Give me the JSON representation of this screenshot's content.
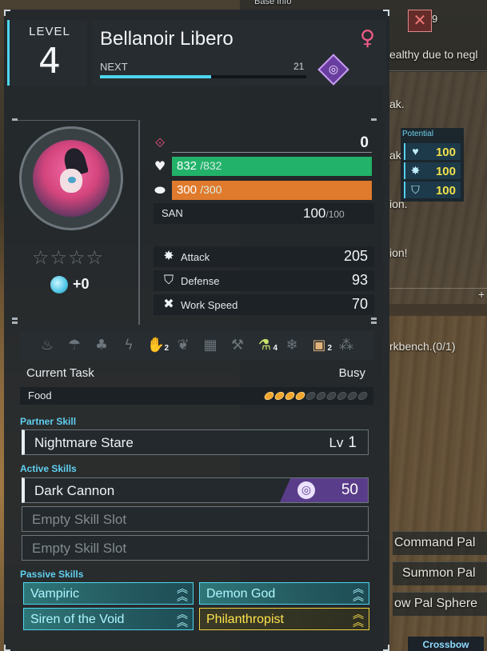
{
  "background": {
    "base_info": "Base Info",
    "notice_count": "9",
    "lines": [
      "ealthy due to negl",
      "ak.",
      "ak.",
      "ion.",
      "ion!"
    ],
    "plus": "+",
    "workbench": "rkbench.(0/1)",
    "buttons": [
      "Command Pal",
      "Summon Pal",
      "ow Pal Sphere"
    ],
    "crossbow": "Crossbow",
    "potential": {
      "label": "Potential",
      "rows": [
        {
          "icon": "heart-icon",
          "value": "100"
        },
        {
          "icon": "attack-icon",
          "value": "100"
        },
        {
          "icon": "shield-icon",
          "value": "100"
        }
      ]
    }
  },
  "header": {
    "level_label": "LEVEL",
    "level": "4",
    "name": "Bellanoir Libero",
    "gender_icon": "female-icon",
    "next_label": "NEXT",
    "next_value": "21",
    "exp_progress": 0.54,
    "element": "dark"
  },
  "profile": {
    "stars": "☆☆☆☆",
    "condense_value": "+0"
  },
  "stats": {
    "rank_value": "0",
    "hp": {
      "current": "832",
      "max": "/832",
      "fraction": 1.0,
      "color": "#22b26a"
    },
    "stamina": {
      "current": "300",
      "max": "/300",
      "fraction": 1.0,
      "color": "#e07a2c"
    },
    "san": {
      "label": "SAN",
      "current": "100",
      "max": "/100"
    },
    "combat": [
      {
        "icon": "attack-icon",
        "label": "Attack",
        "value": "205"
      },
      {
        "icon": "defense-icon",
        "label": "Defense",
        "value": "93"
      },
      {
        "icon": "work-speed-icon",
        "label": "Work Speed",
        "value": "70"
      }
    ]
  },
  "work_suitability": [
    {
      "name": "kindling-icon",
      "level": "",
      "active": false
    },
    {
      "name": "watering-icon",
      "level": "",
      "active": false
    },
    {
      "name": "planting-icon",
      "level": "",
      "active": false
    },
    {
      "name": "electricity-icon",
      "level": "",
      "active": false
    },
    {
      "name": "handiwork-icon",
      "level": "2",
      "active": true
    },
    {
      "name": "gathering-icon",
      "level": "",
      "active": false
    },
    {
      "name": "lumbering-icon",
      "level": "",
      "active": false
    },
    {
      "name": "mining-icon",
      "level": "",
      "active": false
    },
    {
      "name": "medicine-icon",
      "level": "4",
      "active": true
    },
    {
      "name": "cooling-icon",
      "level": "",
      "active": false
    },
    {
      "name": "transporting-icon",
      "level": "2",
      "active": true
    },
    {
      "name": "farming-icon",
      "level": "",
      "active": false
    }
  ],
  "task": {
    "label": "Current Task",
    "value": "Busy"
  },
  "food": {
    "label": "Food",
    "filled": 4,
    "total": 10
  },
  "partner_skill": {
    "title": "Partner Skill",
    "name": "Nightmare Stare",
    "lv_label": "Lv",
    "lv": "1"
  },
  "active_skills": {
    "title": "Active Skills",
    "slots": [
      {
        "name": "Dark Cannon",
        "power": "50"
      },
      {
        "name": "Empty Skill Slot"
      },
      {
        "name": "Empty Skill Slot"
      }
    ]
  },
  "passive_skills": {
    "title": "Passive Skills",
    "items": [
      {
        "name": "Vampiric",
        "tier": "teal"
      },
      {
        "name": "Demon God",
        "tier": "teal"
      },
      {
        "name": "Siren of the Void",
        "tier": "teal"
      },
      {
        "name": "Philanthropist",
        "tier": "gold"
      }
    ]
  }
}
